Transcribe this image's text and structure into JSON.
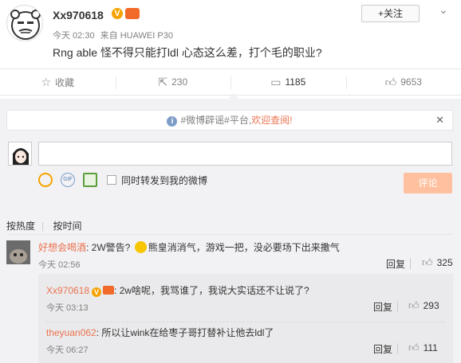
{
  "post": {
    "author": "Xx970618",
    "time": "今天 02:30",
    "source": "来自 HUAWEI P30",
    "text": "Rng able 怪不得只能打ldl 心态这么差，打个毛的职业?",
    "follow_label": "+关注"
  },
  "actions": [
    {
      "icon": "star-icon",
      "label": "收藏"
    },
    {
      "icon": "share-icon",
      "label": "230"
    },
    {
      "icon": "comment-icon",
      "label": "1185"
    },
    {
      "icon": "thumbs-up-icon",
      "label": "9653"
    }
  ],
  "notice": {
    "text": "#微博辟谣#平台,",
    "link": "欢迎查阅!"
  },
  "composer": {
    "forward_label": "同时转发到我的微博",
    "submit_label": "评论"
  },
  "sort": {
    "by_hot": "按热度",
    "by_time": "按时间"
  },
  "comment": {
    "user": "好想会喝酒",
    "text_before": ": 2W警告? ",
    "text_after": "熊皇消消气，游戏一把，没必要场下出来撒气",
    "time": "今天 02:56",
    "reply_label": "回复",
    "likes": "325"
  },
  "replies": [
    {
      "user": "Xx970618",
      "text": ": 2w啥呢，我骂谁了，我说大实话还不让说了?",
      "time": "今天 03:13",
      "reply_label": "回复",
      "likes": "293"
    },
    {
      "user": "theyuan062",
      "text": ": 所以让wink在给枣子哥打替补让他去ldl了",
      "time": "今天 06:27",
      "reply_label": "回复",
      "likes": "111"
    }
  ],
  "colors": {
    "accent_orange": "#eb7350",
    "submit_disabled": "#ffc09f",
    "v_badge": "#f7a300"
  }
}
